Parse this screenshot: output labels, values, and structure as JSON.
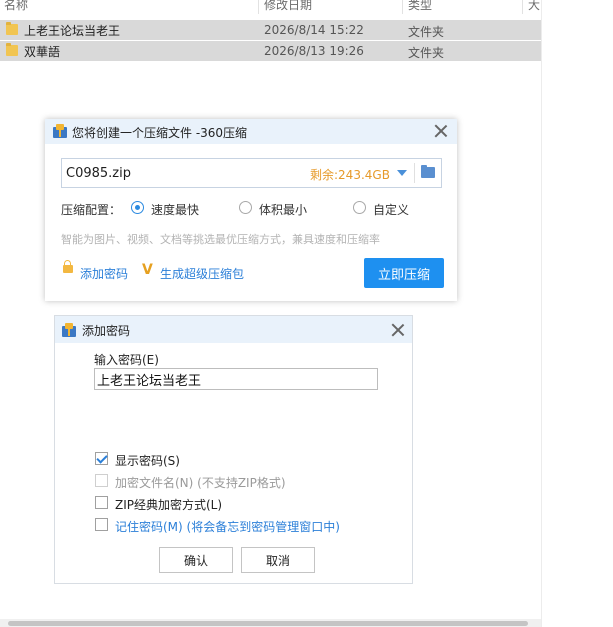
{
  "explorer": {
    "columns": [
      "名称",
      "修改日期",
      "类型",
      "大"
    ],
    "rows": [
      {
        "name": "上老王论坛当老王",
        "date": "2026/8/14 15:22",
        "type": "文件夹"
      },
      {
        "name": "双華語",
        "date": "2026/8/13 19:26",
        "type": "文件夹"
      }
    ]
  },
  "compress": {
    "title": "您将创建一个压缩文件 -360压缩",
    "path": "C0985.zip",
    "free_space": "剩余:243.4GB",
    "config_label": "压缩配置：",
    "options": [
      {
        "label": "速度最快",
        "checked": true
      },
      {
        "label": "体积最小",
        "checked": false
      },
      {
        "label": "自定义",
        "checked": false
      }
    ],
    "hint": "智能为图片、视频、文档等挑选最优压缩方式，兼具速度和压缩率",
    "add_password": "添加密码",
    "super_pack": "生成超级压缩包",
    "compress_now": "立即压缩"
  },
  "password_dialog": {
    "title": "添加密码",
    "field_label": "输入密码(E)",
    "password_value": "上老王论坛当老王",
    "checkboxes": [
      {
        "label": "显示密码(S)",
        "checked": true,
        "disabled": false
      },
      {
        "label": "加密文件名(N) (不支持ZIP格式)",
        "checked": false,
        "disabled": true
      },
      {
        "label": "ZIP经典加密方式(L)",
        "checked": false,
        "disabled": false
      },
      {
        "label": "记住密码(M) (将会备忘到密码管理窗口中)",
        "checked": false,
        "disabled": false
      }
    ],
    "ok": "确认",
    "cancel": "取消"
  },
  "colors": {
    "accent": "#1e90f0",
    "link": "#2b7fd8",
    "warning": "#e69a2a",
    "titlebar": "#e9f2fb"
  }
}
